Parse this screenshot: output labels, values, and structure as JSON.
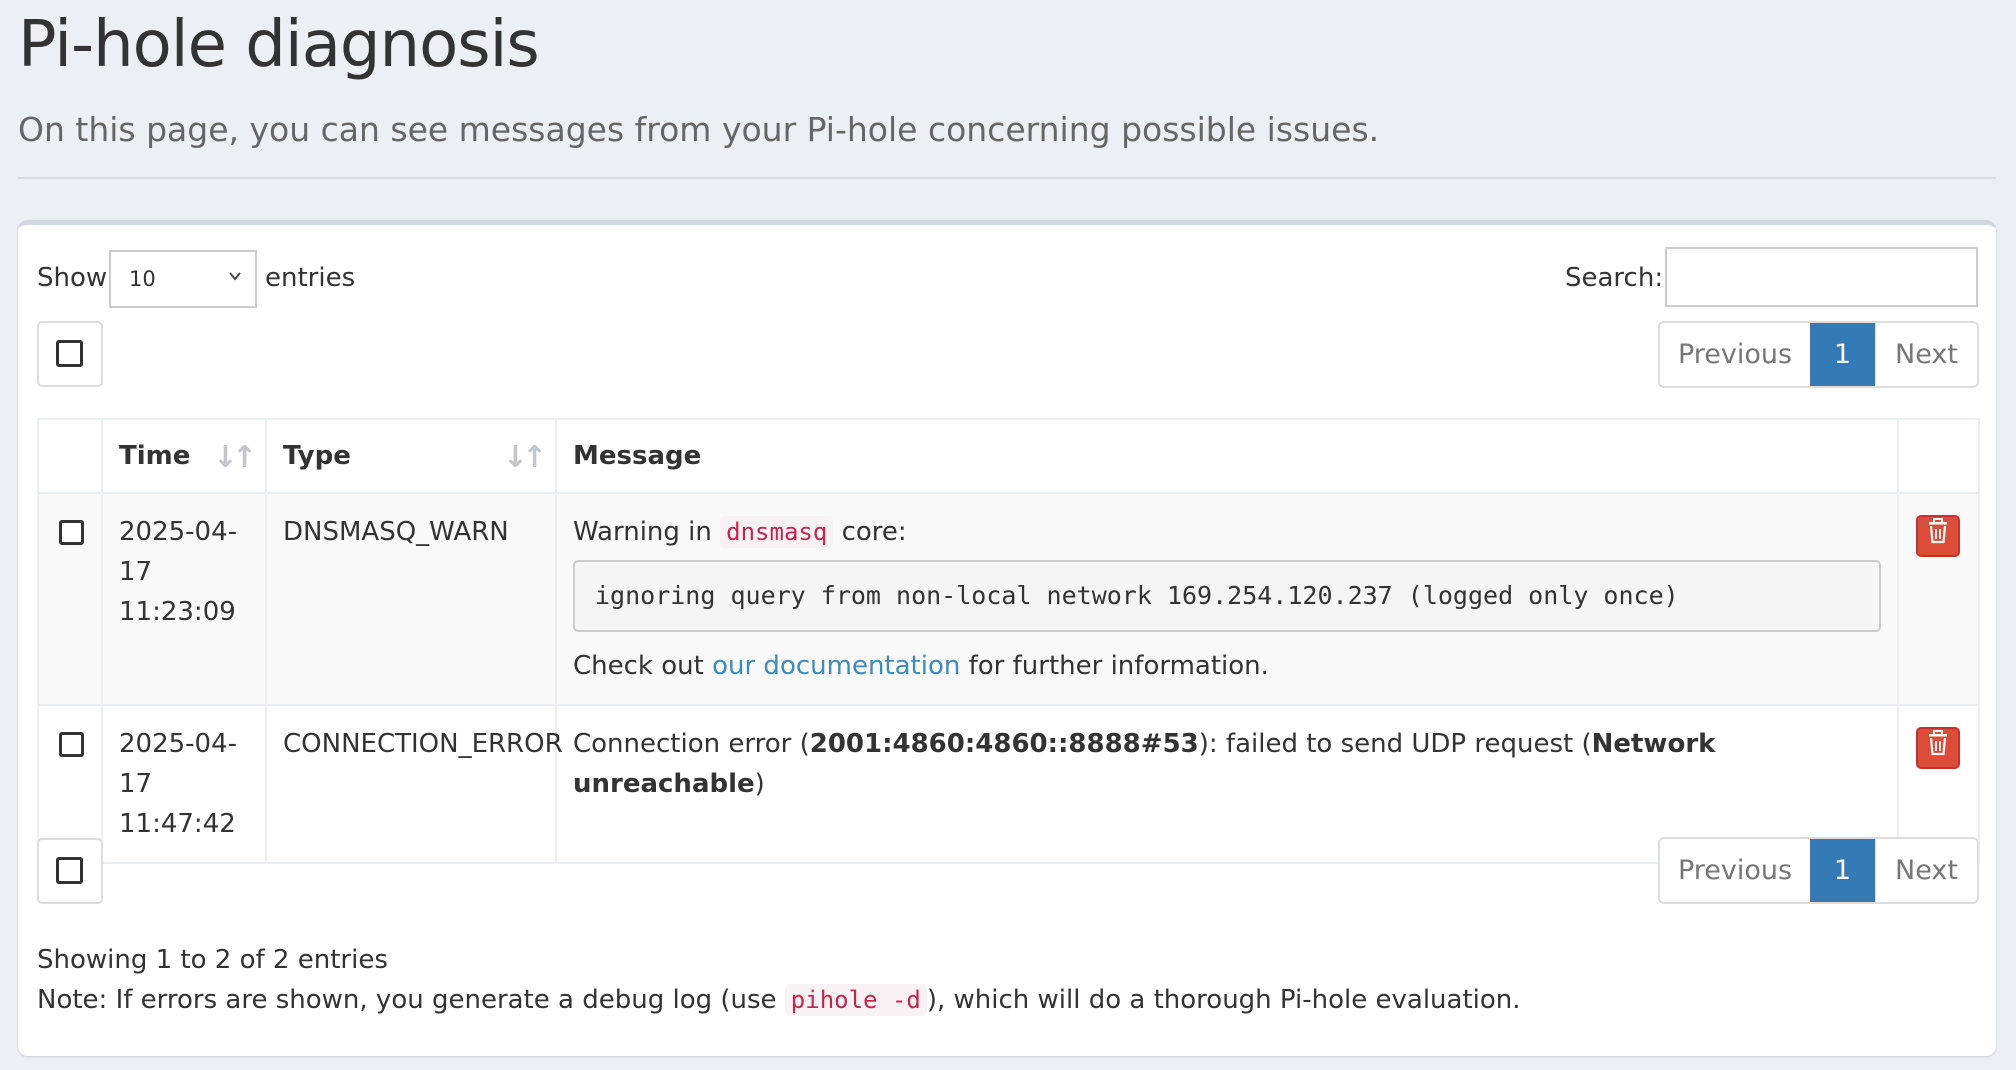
{
  "page": {
    "title": "Pi-hole diagnosis",
    "subtitle": "On this page, you can see messages from your Pi-hole concerning possible issues."
  },
  "table_controls": {
    "show_label": "Show",
    "page_length": "10",
    "entries_label": "entries",
    "search_label": "Search:",
    "search_value": ""
  },
  "pagination": {
    "previous": "Previous",
    "current_page": "1",
    "next": "Next"
  },
  "columns": [
    "Time",
    "Type",
    "Message"
  ],
  "rows": [
    {
      "date": "2025-04-17",
      "time": "11:23:09",
      "type": "DNSMASQ_WARN",
      "msg_prefix": "Warning in",
      "msg_code": "dnsmasq",
      "msg_suffix": "core:",
      "log": "ignoring query from non-local network 169.254.120.237 (logged only once)",
      "doc_prefix": "Check out",
      "doc_link": "our documentation",
      "doc_suffix": "for further information."
    },
    {
      "date": "2025-04-17",
      "time": "11:47:42",
      "type": "CONNECTION_ERROR",
      "msg_a": "Connection error (",
      "msg_bold1": "2001:4860:4860::8888#53",
      "msg_b": "): failed to send UDP request (",
      "msg_bold2": "Network unreachable",
      "msg_c": ")"
    }
  ],
  "footer": {
    "info": "Showing 1 to 2 of 2 entries",
    "note_prefix": "Note: If errors are shown, you generate a debug log (use",
    "note_code": "pihole -d",
    "note_suffix": "), which will do a thorough Pi-hole evaluation."
  },
  "icons": {
    "sort": "sort-both-icon",
    "delete": "trash-icon",
    "dropdown": "chevron-down-icon"
  },
  "colors": {
    "background": "#ecf0f5",
    "primary": "#337ab7",
    "danger": "#dd4b39",
    "link": "#3c8dbc",
    "code": "#c7254e"
  }
}
